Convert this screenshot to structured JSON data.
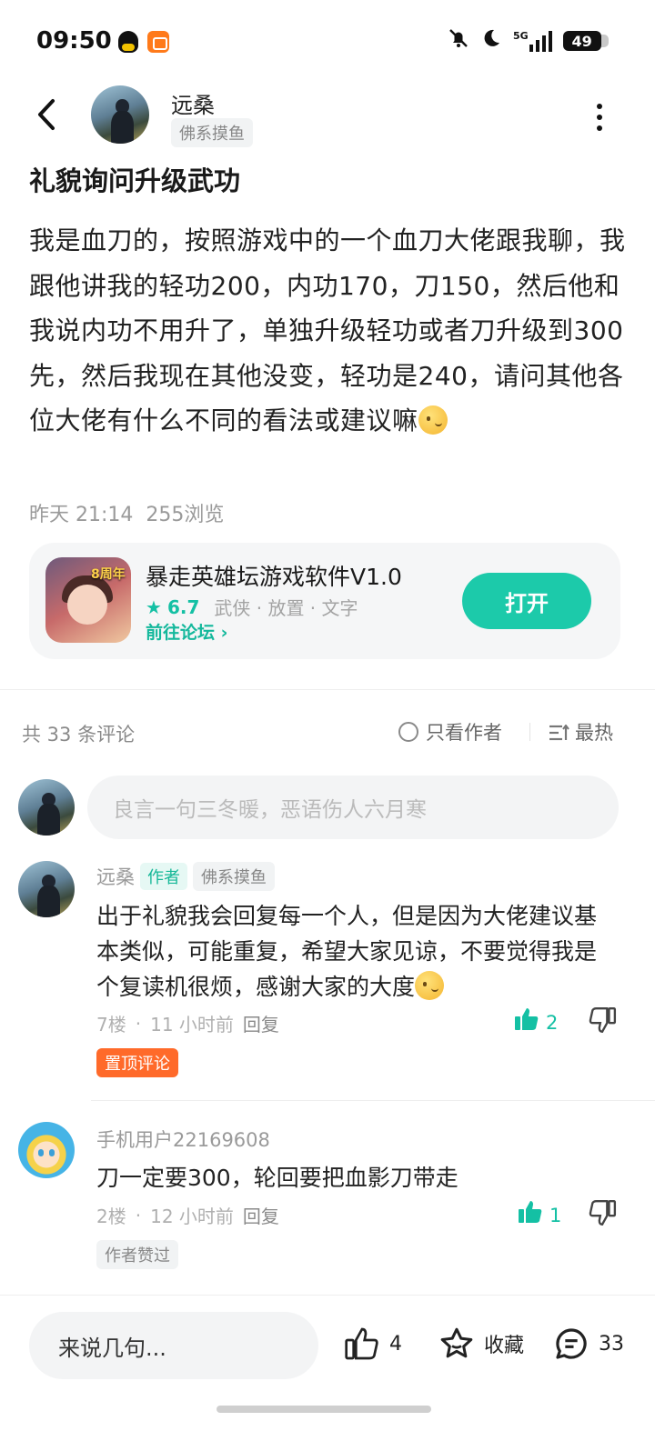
{
  "status_bar": {
    "time": "09:50",
    "network": "5G",
    "battery": "49"
  },
  "post": {
    "author_name": "远桑",
    "author_tag": "佛系摸鱼",
    "title": "礼貌询问升级武功",
    "body": "我是血刀的，按照游戏中的一个血刀大佬跟我聊，我跟他讲我的轻功200，内功170，刀150，然后他和我说内功不用升了，单独升级轻功或者刀升级到300先，然后我现在其他没变，轻功是240，请问其他各位大佬有什么不同的看法或建议嘛",
    "time": "昨天 21:14",
    "views": "255浏览"
  },
  "game_card": {
    "icon_badge": "8周年",
    "title": "暴走英雄坛游戏软件V1.0",
    "rating": "6.7",
    "genres": "武侠 · 放置 · 文字",
    "forum_link": "前往论坛",
    "open_button": "打开"
  },
  "comments_header": {
    "count": "共 33 条评论",
    "author_only": "只看作者",
    "sort": "最热"
  },
  "comment_input_placeholder": "良言一句三冬暖，恶语伤人六月寒",
  "comments": [
    {
      "name": "远桑",
      "author_badge": "作者",
      "tag": "佛系摸鱼",
      "text": "出于礼貌我会回复每一个人，但是因为大佬建议基本类似，可能重复，希望大家见谅，不要觉得我是个复读机很烦，感谢大家的大度",
      "floor": "7楼",
      "time": "11 小时前",
      "reply": "回复",
      "likes": "2",
      "label": "置顶评论"
    },
    {
      "name": "手机用户22169608",
      "text": "刀一定要300，轮回要把血影刀带走",
      "floor": "2楼",
      "time": "12 小时前",
      "reply": "回复",
      "likes": "1",
      "label": "作者赞过"
    }
  ],
  "bottom_bar": {
    "input": "来说几句...",
    "likes": "4",
    "favorite": "收藏",
    "comments": "33"
  },
  "colors": {
    "accent": "#1ccaaa",
    "pin": "#ff6a2a"
  },
  "icons": [
    "back-arrow-icon",
    "more-vertical-icon",
    "star-icon",
    "thumb-up-icon",
    "thumb-down-icon",
    "favorite-star-icon",
    "comment-bubble-icon",
    "sort-icon",
    "radio-icon"
  ]
}
